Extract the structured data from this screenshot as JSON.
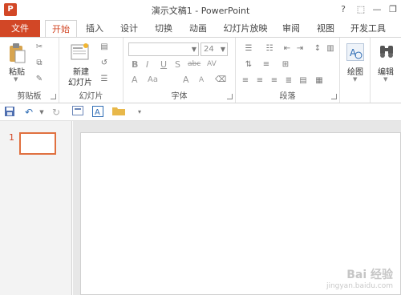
{
  "titlebar": {
    "app_icon": "P",
    "title": "演示文稿1 - PowerPoint",
    "help": "?",
    "ribbon_display": "⬚",
    "minimize": "—",
    "restore": "❐"
  },
  "tabs": {
    "file": "文件",
    "items": [
      "开始",
      "插入",
      "设计",
      "切换",
      "动画",
      "幻灯片放映",
      "审阅",
      "视图",
      "开发工具"
    ]
  },
  "ribbon": {
    "clipboard": {
      "paste": "粘贴",
      "label": "剪贴板"
    },
    "slides": {
      "new_slide_1": "新建",
      "new_slide_2": "幻灯片",
      "label": "幻灯片"
    },
    "font": {
      "font_name": "",
      "font_size": "24",
      "bold": "B",
      "italic": "I",
      "underline": "U",
      "strike": "S",
      "shadow": "abc",
      "spacing": "AV",
      "font_color": "A",
      "case": "Aa",
      "grow": "A",
      "shrink": "A",
      "label": "字体"
    },
    "paragraph": {
      "label": "段落"
    },
    "drawing": {
      "label": "绘图"
    },
    "editing": {
      "label": "编辑"
    }
  },
  "slides_pane": {
    "slide_number": "1"
  },
  "watermark": {
    "line1": "Bai 经验",
    "line2": "jingyan.baidu.com"
  },
  "colors": {
    "accent": "#d24726",
    "thumb_border": "#e0703f"
  }
}
